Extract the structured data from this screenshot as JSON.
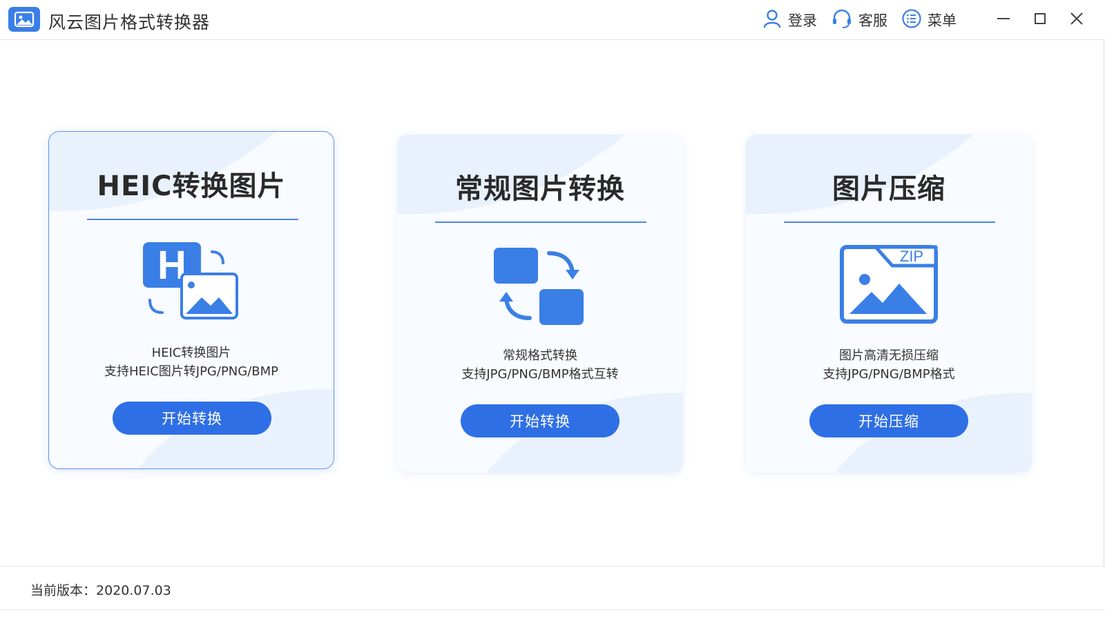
{
  "app": {
    "title": "风云图片格式转换器",
    "brand_color": "#3a7fe6",
    "logo_icon": "picture-logo-icon"
  },
  "header": {
    "actions": [
      {
        "label": "登录",
        "icon": "user-icon"
      },
      {
        "label": "客服",
        "icon": "headset-icon"
      },
      {
        "label": "菜单",
        "icon": "menu-list-icon"
      }
    ],
    "window_controls": [
      "minimize-icon",
      "maximize-icon",
      "close-icon"
    ]
  },
  "cards": [
    {
      "title": "HEIC转换图片",
      "icon": "heic-convert-icon",
      "desc_line1": "HEIC转换图片",
      "desc_line2": "支持HEIC图片转JPG/PNG/BMP",
      "button": "开始转换",
      "selected": true
    },
    {
      "title": "常规图片转换",
      "icon": "format-swap-icon",
      "desc_line1": "常规格式转换",
      "desc_line2": "支持JPG/PNG/BMP格式互转",
      "button": "开始转换",
      "selected": false
    },
    {
      "title": "图片压缩",
      "icon": "zip-image-icon",
      "desc_line1": "图片高清无损压缩",
      "desc_line2": "支持JPG/PNG/BMP格式",
      "button": "开始压缩",
      "selected": false
    }
  ],
  "footer": {
    "version_text": "当前版本：2020.07.03"
  },
  "colors": {
    "accent": "#2f6fe5",
    "card_bg": "#f8fbff",
    "wave": "#e6effb"
  }
}
